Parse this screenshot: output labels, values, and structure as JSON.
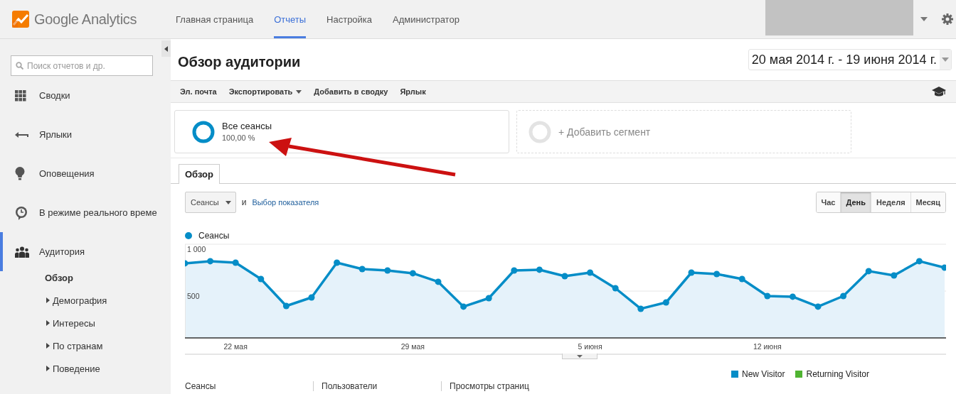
{
  "logo_text": "Google Analytics",
  "nav": [
    {
      "label": "Главная страница",
      "selected": false
    },
    {
      "label": "Отчеты",
      "selected": true
    },
    {
      "label": "Настройка",
      "selected": false
    },
    {
      "label": "Администратор",
      "selected": false
    }
  ],
  "sidebar": {
    "search_placeholder": "Поиск отчетов и др.",
    "items": [
      {
        "kind": "grid",
        "label": "Сводки",
        "selected": false
      },
      {
        "kind": "shortcut",
        "label": "Ярлыки",
        "selected": false
      },
      {
        "kind": "bulb",
        "label": "Оповещения",
        "selected": false
      },
      {
        "kind": "clock",
        "label": "В режиме реального време",
        "selected": false
      },
      {
        "kind": "people",
        "label": "Аудитория",
        "selected": true,
        "children": [
          {
            "kind": "page",
            "label": "Обзор",
            "selected": true
          },
          {
            "kind": "group",
            "label": "Демография",
            "selected": false,
            "expanded": false
          },
          {
            "kind": "group",
            "label": "Интересы",
            "selected": false,
            "expanded": false
          },
          {
            "kind": "group",
            "label": "По странам",
            "selected": false,
            "expanded": false
          },
          {
            "kind": "group",
            "label": "Поведение",
            "selected": false,
            "expanded": false
          }
        ]
      }
    ]
  },
  "report": {
    "title": "Обзор аудитории",
    "date_range": "20 мая 2014 г. - 19 июня 2014 г.",
    "toolbar": [
      {
        "label": "Эл. почта",
        "dropdown": false
      },
      {
        "label": "Экспортировать",
        "dropdown": true
      },
      {
        "label": "Добавить в сводку",
        "dropdown": false
      },
      {
        "label": "Ярлык",
        "dropdown": false
      }
    ],
    "segments": [
      {
        "kind": "active",
        "name": "Все сеансы",
        "share": "100,00 %"
      },
      {
        "kind": "add",
        "name": "+ Добавить сегмент"
      }
    ],
    "overlay_arrow": true,
    "tabs": [
      {
        "label": "Обзор",
        "selected": true
      }
    ],
    "metric_select": "Сеансы",
    "conjunction": "и",
    "metric_link": "Выбор показателя",
    "granularity": [
      {
        "label": "Час",
        "selected": false
      },
      {
        "label": "День",
        "selected": true
      },
      {
        "label": "Неделя",
        "selected": false
      },
      {
        "label": "Месяц",
        "selected": false
      }
    ],
    "chart_data": {
      "type": "area",
      "categories": [
        null,
        null,
        "22 мая",
        null,
        null,
        null,
        null,
        null,
        null,
        "29 мая",
        null,
        null,
        null,
        null,
        null,
        null,
        "5 июня",
        null,
        null,
        null,
        null,
        null,
        null,
        "12 июня",
        null,
        null,
        null,
        null,
        null,
        null,
        null
      ],
      "series": [
        {
          "name": "Сеансы",
          "color": "#058dc7",
          "values": [
            796,
            819,
            803,
            629,
            341,
            432,
            803,
            735,
            720,
            690,
            599,
            334,
            424,
            720,
            728,
            659,
            697,
            530,
            311,
            379,
            697,
            682,
            629,
            447,
            440,
            334,
            447,
            713,
            667,
            819,
            750
          ]
        }
      ],
      "ylim": [
        0,
        1000
      ],
      "yticks": [
        {
          "value": 500,
          "label": "500"
        },
        {
          "value": 1000,
          "label": "1 000"
        }
      ]
    },
    "visitor_legend": [
      {
        "label": "New Visitor",
        "color": "#058dc7"
      },
      {
        "label": "Returning Visitor",
        "color": "#50b432"
      }
    ],
    "summary_columns": [
      "Сеансы",
      "Пользователи",
      "Просмотры страниц"
    ]
  }
}
